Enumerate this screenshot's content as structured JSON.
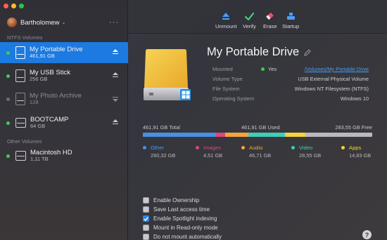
{
  "app": {
    "colors": {
      "selection": "#1d7ae0",
      "mounted_dot": "#3bd14b",
      "unmounted_dot": "#6d6d72",
      "link": "#4d9bf0"
    }
  },
  "sidebar": {
    "user_name": "Bartholomew",
    "caret": "⌄",
    "more": "···",
    "section_ntfs": "NTFS Volumes",
    "section_other": "Other Volumes",
    "volumes": [
      {
        "name": "My Portable Drive",
        "size": "461,91 GB",
        "mounted": true,
        "selected": true
      },
      {
        "name": "My USB Stick",
        "size": "256 GB",
        "mounted": true,
        "selected": false
      },
      {
        "name": "My Photo Archive",
        "size": "128",
        "mounted": false,
        "selected": false
      },
      {
        "name": "BOOTCAMP",
        "size": "64 GB",
        "mounted": true,
        "selected": false
      }
    ],
    "other_volumes": [
      {
        "name": "Macintosh HD",
        "size": "1,11 TB",
        "mounted": true
      }
    ]
  },
  "toolbar": {
    "unmount_label": "Unmount",
    "verify_label": "Verify",
    "erase_label": "Erase",
    "startup_label": "Startup",
    "icons": [
      "eject-icon",
      "checkmark-icon",
      "eraser-icon",
      "startup-disk-icon"
    ]
  },
  "details": {
    "title": "My Portable Drive",
    "mounted_label": "Mounted",
    "mounted_value": "Yes",
    "mount_path": "/Volumes/My Portable Drive",
    "volume_type_label": "Volume Type",
    "volume_type_value": "USB External Physical Volume",
    "file_system_label": "File System",
    "file_system_value": "Windows NT Filesystem (NTFS)",
    "os_label": "Operating System",
    "os_value": "Windows 10"
  },
  "usage": {
    "total": "461,91 GB Total",
    "used": "461,91 GB Used",
    "free": "283,55 GB Free",
    "segments": [
      {
        "name": "Other",
        "size": "260,32 GB",
        "color": "#4a90e2",
        "fraction": 0.32
      },
      {
        "name": "Images",
        "size": "4,51 GB",
        "color": "#e0457b",
        "fraction": 0.04
      },
      {
        "name": "Audio",
        "size": "46,71 GB",
        "color": "#f3a53c",
        "fraction": 0.1
      },
      {
        "name": "Video",
        "size": "28,55 GB",
        "color": "#3fcfb8",
        "fraction": 0.16
      },
      {
        "name": "Apps",
        "size": "14,83 GB",
        "color": "#f1d43a",
        "fraction": 0.09
      },
      {
        "name": "Free",
        "size": "",
        "color": "#b9b9bf",
        "fraction": 0.29
      }
    ]
  },
  "options": [
    {
      "label": "Enable Ownership",
      "checked": false
    },
    {
      "label": "Save Last access time",
      "checked": false
    },
    {
      "label": "Enable Spotlight indexing",
      "checked": true
    },
    {
      "label": "Mount in Read-only mode",
      "checked": false
    },
    {
      "label": "Do not mount automatically",
      "checked": false
    }
  ],
  "help_label": "?"
}
